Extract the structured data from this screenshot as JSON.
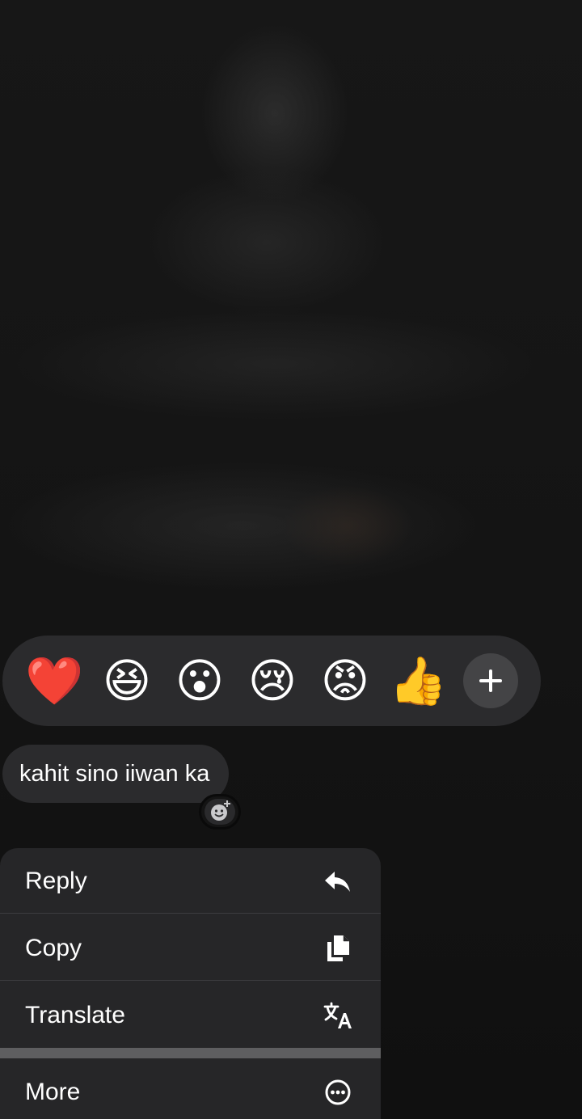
{
  "reactions": {
    "emojis": [
      {
        "name": "red-heart",
        "glyph": "❤️"
      },
      {
        "name": "laughing",
        "glyph": "😆"
      },
      {
        "name": "surprised",
        "glyph": "😮"
      },
      {
        "name": "crying",
        "glyph": "😢"
      },
      {
        "name": "angry",
        "glyph": "😡"
      },
      {
        "name": "thumbs-up",
        "glyph": "👍"
      }
    ],
    "more_icon": "plus-icon"
  },
  "message": {
    "text": "kahit sino iiwan ka",
    "add_reaction_icon": "add-reaction-icon"
  },
  "menu": {
    "items": [
      {
        "label": "Reply",
        "icon": "reply-icon"
      },
      {
        "label": "Copy",
        "icon": "copy-icon"
      },
      {
        "label": "Translate",
        "icon": "translate-icon"
      },
      {
        "label": "More",
        "icon": "more-icon"
      }
    ]
  },
  "colors": {
    "background": "#141414",
    "surface": "#2b2b2d",
    "menu_surface": "#262628",
    "text": "#ffffff"
  }
}
